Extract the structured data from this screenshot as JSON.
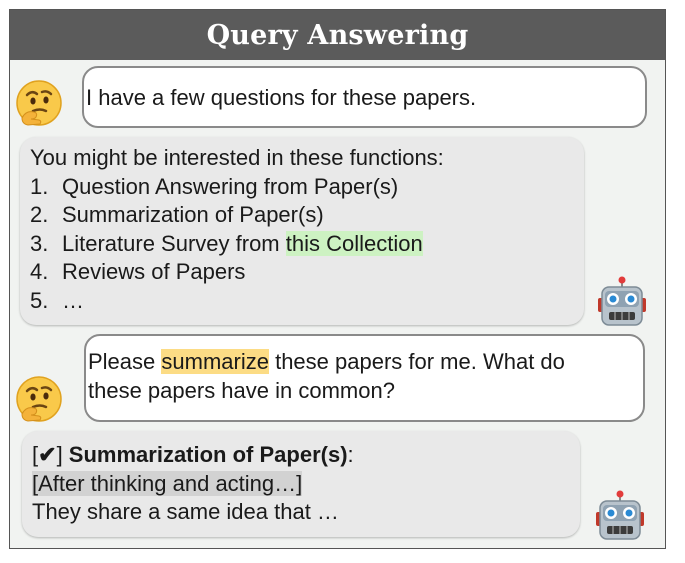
{
  "title": "Query Answering",
  "messages": {
    "user1": {
      "text": "I have a few questions for these papers."
    },
    "bot1": {
      "intro": "You might be interested in these functions:",
      "items": [
        {
          "num": "1.",
          "text": "Question Answering from Paper(s)"
        },
        {
          "num": "2.",
          "text": "Summarization of Paper(s)"
        },
        {
          "num": "3.",
          "text": "Literature Survey from ",
          "highlight": "this Collection"
        },
        {
          "num": "4.",
          "text": "Reviews of Papers"
        },
        {
          "num": "5.",
          "text": "…"
        }
      ]
    },
    "user2": {
      "before": "Please ",
      "highlight": "summarize",
      "after_line1": " these papers for me. What do",
      "line2": "these papers have in common?"
    },
    "bot2": {
      "check_open": "[",
      "check_mark": "✔",
      "check_close": "] ",
      "func_name": "Summarization of Paper(s)",
      "colon": ":",
      "thinking": "[After thinking and acting…]",
      "result": "They share a same idea that …"
    }
  },
  "icons": {
    "user": "thinking-face-icon",
    "bot": "robot-face-icon"
  },
  "colors": {
    "title_bar": "#5b5b5b",
    "panel_bg": "#f1f3f1",
    "user_bubble_border": "#8a8a8a",
    "bot_bubble_bg": "#e9e9e9",
    "highlight_green": "#cdf2c2",
    "highlight_yellow": "#fcdc85",
    "highlight_gray": "#d2d2d2"
  }
}
